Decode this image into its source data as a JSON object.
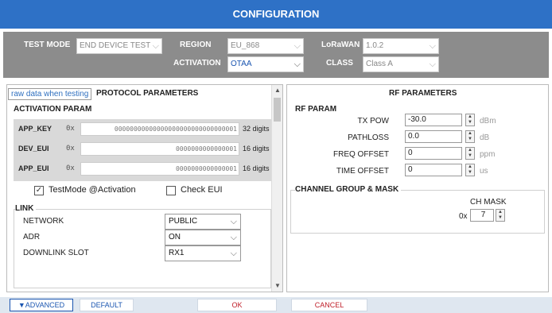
{
  "window": {
    "title": "CONFIGURATION"
  },
  "topbar": {
    "test_mode_label": "TEST MODE",
    "test_mode_value": "END DEVICE TEST",
    "region_label": "REGION",
    "region_value": "EU_868",
    "activation_label": "ACTIVATION",
    "activation_value": "OTAA",
    "lorawan_label": "LoRaWAN",
    "lorawan_value": "1.0.2",
    "class_label": "CLASS",
    "class_value": "Class A"
  },
  "protocol": {
    "title": "PROTOCOL PARAMETERS",
    "tooltip": "raw data when testing",
    "activation_title": "ACTIVATION PARAM",
    "keys": [
      {
        "label": "APP_KEY",
        "prefix": "0x",
        "value": "00000000000000000000000000000001",
        "digits": "32 digits"
      },
      {
        "label": "DEV_EUI",
        "prefix": "0x",
        "value": "0000000000000001",
        "digits": "16 digits"
      },
      {
        "label": "APP_EUI",
        "prefix": "0x",
        "value": "0000000000000001",
        "digits": "16 digits"
      }
    ],
    "testmode_activation": {
      "label": "TestMode @Activation",
      "checked": true,
      "mark": "✓"
    },
    "check_eui": {
      "label": "Check EUI",
      "checked": false,
      "mark": ""
    },
    "link_title": "LINK",
    "link": [
      {
        "label": "NETWORK",
        "value": "PUBLIC"
      },
      {
        "label": "ADR",
        "value": "ON"
      },
      {
        "label": "DOWNLINK SLOT",
        "value": "RX1"
      }
    ]
  },
  "rf": {
    "title": "RF PARAMETERS",
    "param_title": "RF PARAM",
    "fields": [
      {
        "label": "TX POW",
        "value": "-30.0",
        "unit": "dBm"
      },
      {
        "label": "PATHLOSS",
        "value": "0.0",
        "unit": "dB"
      },
      {
        "label": "FREQ OFFSET",
        "value": "0",
        "unit": "ppm"
      },
      {
        "label": "TIME OFFSET",
        "value": "0",
        "unit": "us"
      }
    ],
    "channel_title": "CHANNEL GROUP & MASK",
    "ch_mask_label": "CH MASK",
    "ch_mask_prefix": "0x",
    "ch_mask_value": "7"
  },
  "bottom": {
    "advanced_label": "▼ADVANCED",
    "default_label": "DEFAULT",
    "ok_label": "OK",
    "cancel_label": "CANCEL"
  },
  "icons": {
    "chevron": "chevron-down-icon",
    "spin": "spinner-icon"
  },
  "colors": {
    "title_bar": "#2e71c6",
    "top_bar": "#8c8c8c",
    "accent": "#1a55b0",
    "ok_text": "#c0202a"
  }
}
